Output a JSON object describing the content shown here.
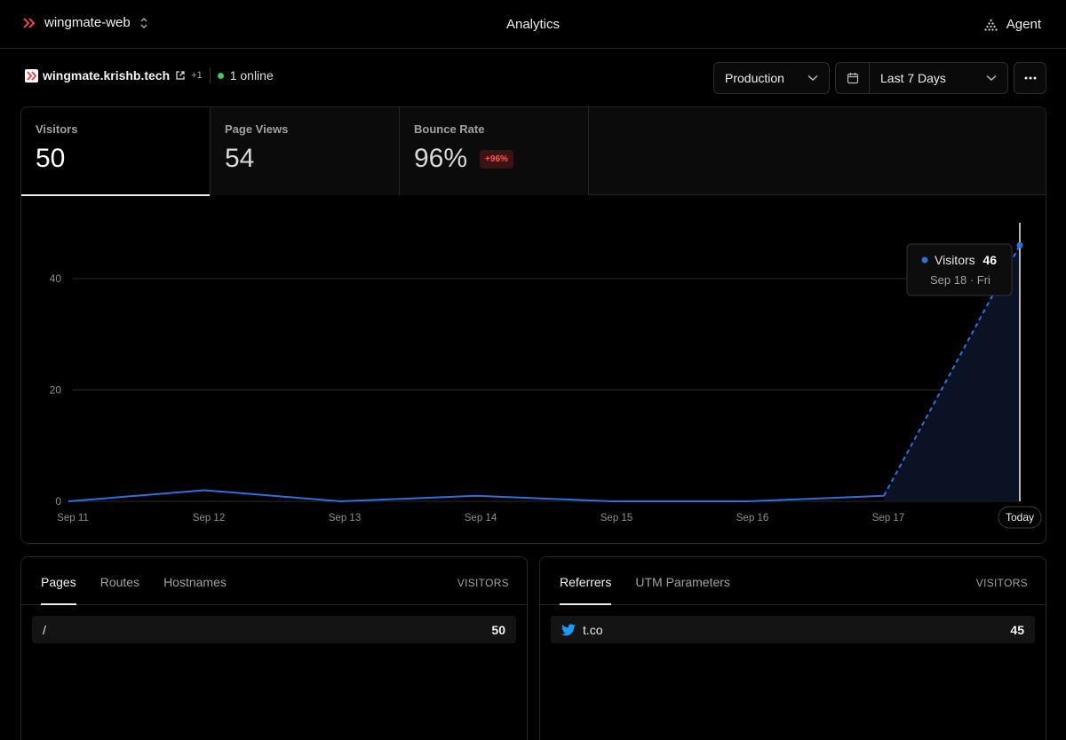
{
  "topbar": {
    "project": "wingmate-web",
    "title": "Analytics",
    "agent_label": "Agent"
  },
  "site": {
    "domain": "wingmate.krishb.tech",
    "extra": "+1",
    "online": "1 online"
  },
  "controls": {
    "environment": "Production",
    "range": "Last 7 Days"
  },
  "stats": [
    {
      "label": "Visitors",
      "value": "50"
    },
    {
      "label": "Page Views",
      "value": "54"
    },
    {
      "label": "Bounce Rate",
      "value": "96%",
      "badge": "+96%"
    }
  ],
  "chart_data": {
    "type": "line",
    "x": [
      "Sep 11",
      "Sep 12",
      "Sep 13",
      "Sep 14",
      "Sep 15",
      "Sep 16",
      "Sep 17",
      "Today"
    ],
    "series": [
      {
        "name": "Visitors",
        "values": [
          0,
          2,
          0,
          1,
          0,
          0,
          1,
          46
        ]
      }
    ],
    "ylim": [
      0,
      50
    ],
    "yticks": [
      0,
      20,
      40
    ],
    "grid": true,
    "tooltip": {
      "series": "Visitors",
      "value": "46",
      "date": "Sep 18 · Fri"
    },
    "colors": {
      "line": "#2f6fe0",
      "grid": "#2a2a2a"
    }
  },
  "pages_panel": {
    "tabs": [
      "Pages",
      "Routes",
      "Hostnames"
    ],
    "column": "VISITORS",
    "rows": [
      {
        "key": "/",
        "value": "50"
      }
    ]
  },
  "referrers_panel": {
    "tabs": [
      "Referrers",
      "UTM Parameters"
    ],
    "column": "VISITORS",
    "rows": [
      {
        "key": "t.co",
        "value": "45",
        "icon": "twitter-icon"
      }
    ]
  }
}
